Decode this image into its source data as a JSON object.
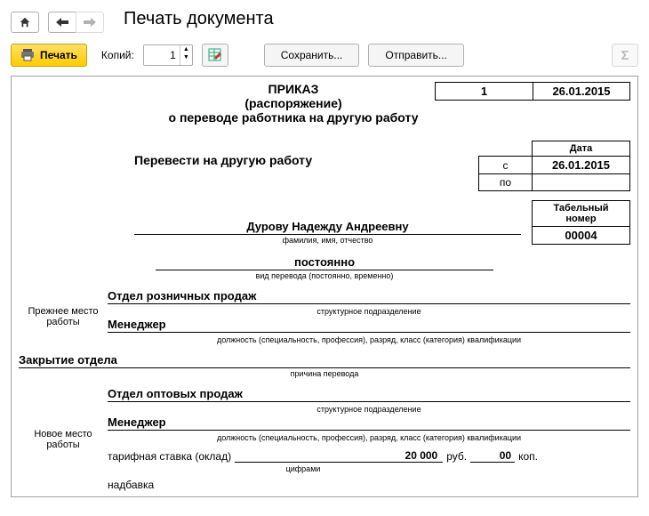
{
  "window": {
    "title": "Печать документа"
  },
  "toolbar": {
    "print": "Печать",
    "copies_label": "Копий:",
    "copies_value": "1",
    "save": "Сохранить...",
    "send": "Отправить..."
  },
  "doc": {
    "heading": {
      "line1": "ПРИКАЗ",
      "line2": "(распоряжение)",
      "line3": "о переводе работника на другую работу",
      "number": "1",
      "date": "26.01.2015"
    },
    "transfer": {
      "label": "Перевести на другую работу",
      "col_date": "Дата",
      "row_from": "с",
      "row_to": "по",
      "from_date": "26.01.2015",
      "to_date": ""
    },
    "tabel": {
      "label": "Табельный номер",
      "value": "00004"
    },
    "employee": {
      "name": "Дурову Надежду Андреевну",
      "caption": "фамилия, имя, отчество"
    },
    "kind": {
      "value": "постоянно",
      "caption": "вид перевода (постоянно, временно)"
    },
    "prev": {
      "title1": "Прежнее место",
      "title2": "работы",
      "unit": "Отдел розничных продаж",
      "unit_caption": "структурное подразделение",
      "position": "Менеджер",
      "position_caption": "должность (специальность, профессия), разряд, класс (категория) квалификации"
    },
    "reason": {
      "value": "Закрытие отдела",
      "caption": "причина перевода"
    },
    "new": {
      "title1": "Новое место",
      "title2": "работы",
      "unit": "Отдел оптовых продаж",
      "unit_caption": "структурное подразделение",
      "position": "Менеджер",
      "position_caption": "должность (специальность, профессия), разряд, класс (категория) квалификации",
      "salary_label": "тарифная ставка (оклад)",
      "salary_value": "20 000",
      "rub": "руб.",
      "kop_value": "00",
      "kop": "коп.",
      "salary_caption": "цифрами",
      "addon_label": "надбавка"
    }
  }
}
